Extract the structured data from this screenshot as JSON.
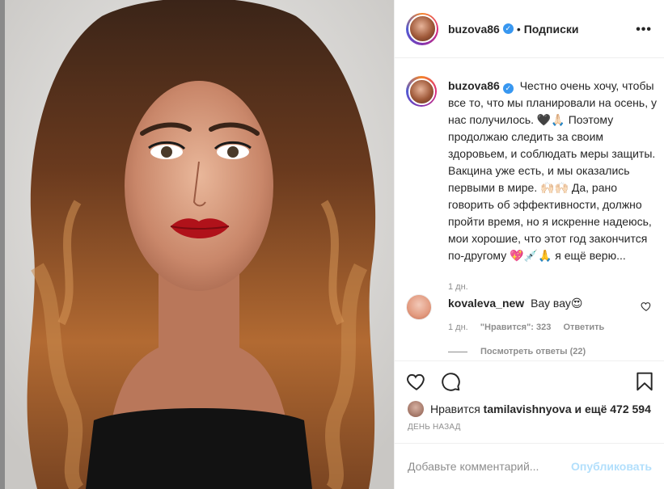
{
  "post": {
    "author": "buzova86",
    "verified_mark": "✓",
    "separator": "•",
    "follow_label": "Подписки",
    "more_icon": "•••",
    "caption": "Честно очень хочу, чтобы все то, что мы планировали на осень, у нас получилось. 🖤🙏🏻 Поэтому продолжаю следить за своим здоровьем, и соблюдать меры защиты. Вакцина уже есть, и мы оказались первыми в мире. 🙌🏻🙌🏻 Да, рано говорить об эффективности, должно пройти время, но я искренне надеюсь, мои хорошие, что этот год закончится по-другому 💖💉🙏 я ещё верю...",
    "caption_time": "1 дн."
  },
  "comment": {
    "user": "kovaleva_new",
    "text": "Вау вау😍",
    "time": "1 дн.",
    "likes_label": "\"Нравится\": 323",
    "reply_label": "Ответить",
    "view_replies": "Посмотреть ответы (22)"
  },
  "likes": {
    "prefix": "Нравится",
    "user": "tamilavishnyova",
    "suffix": "и ещё 472 594"
  },
  "timestamp": "День назад",
  "add_comment": {
    "placeholder": "Добавьте комментарий...",
    "publish_label": "Опубликовать"
  },
  "icons": {
    "like": "heart-icon",
    "comment": "comment-icon",
    "save": "bookmark-icon",
    "comment_like": "heart-icon"
  },
  "colors": {
    "link_disabled": "#b2dffc",
    "verified": "#3897f0",
    "muted": "#8e8e8e",
    "text": "#262626"
  }
}
